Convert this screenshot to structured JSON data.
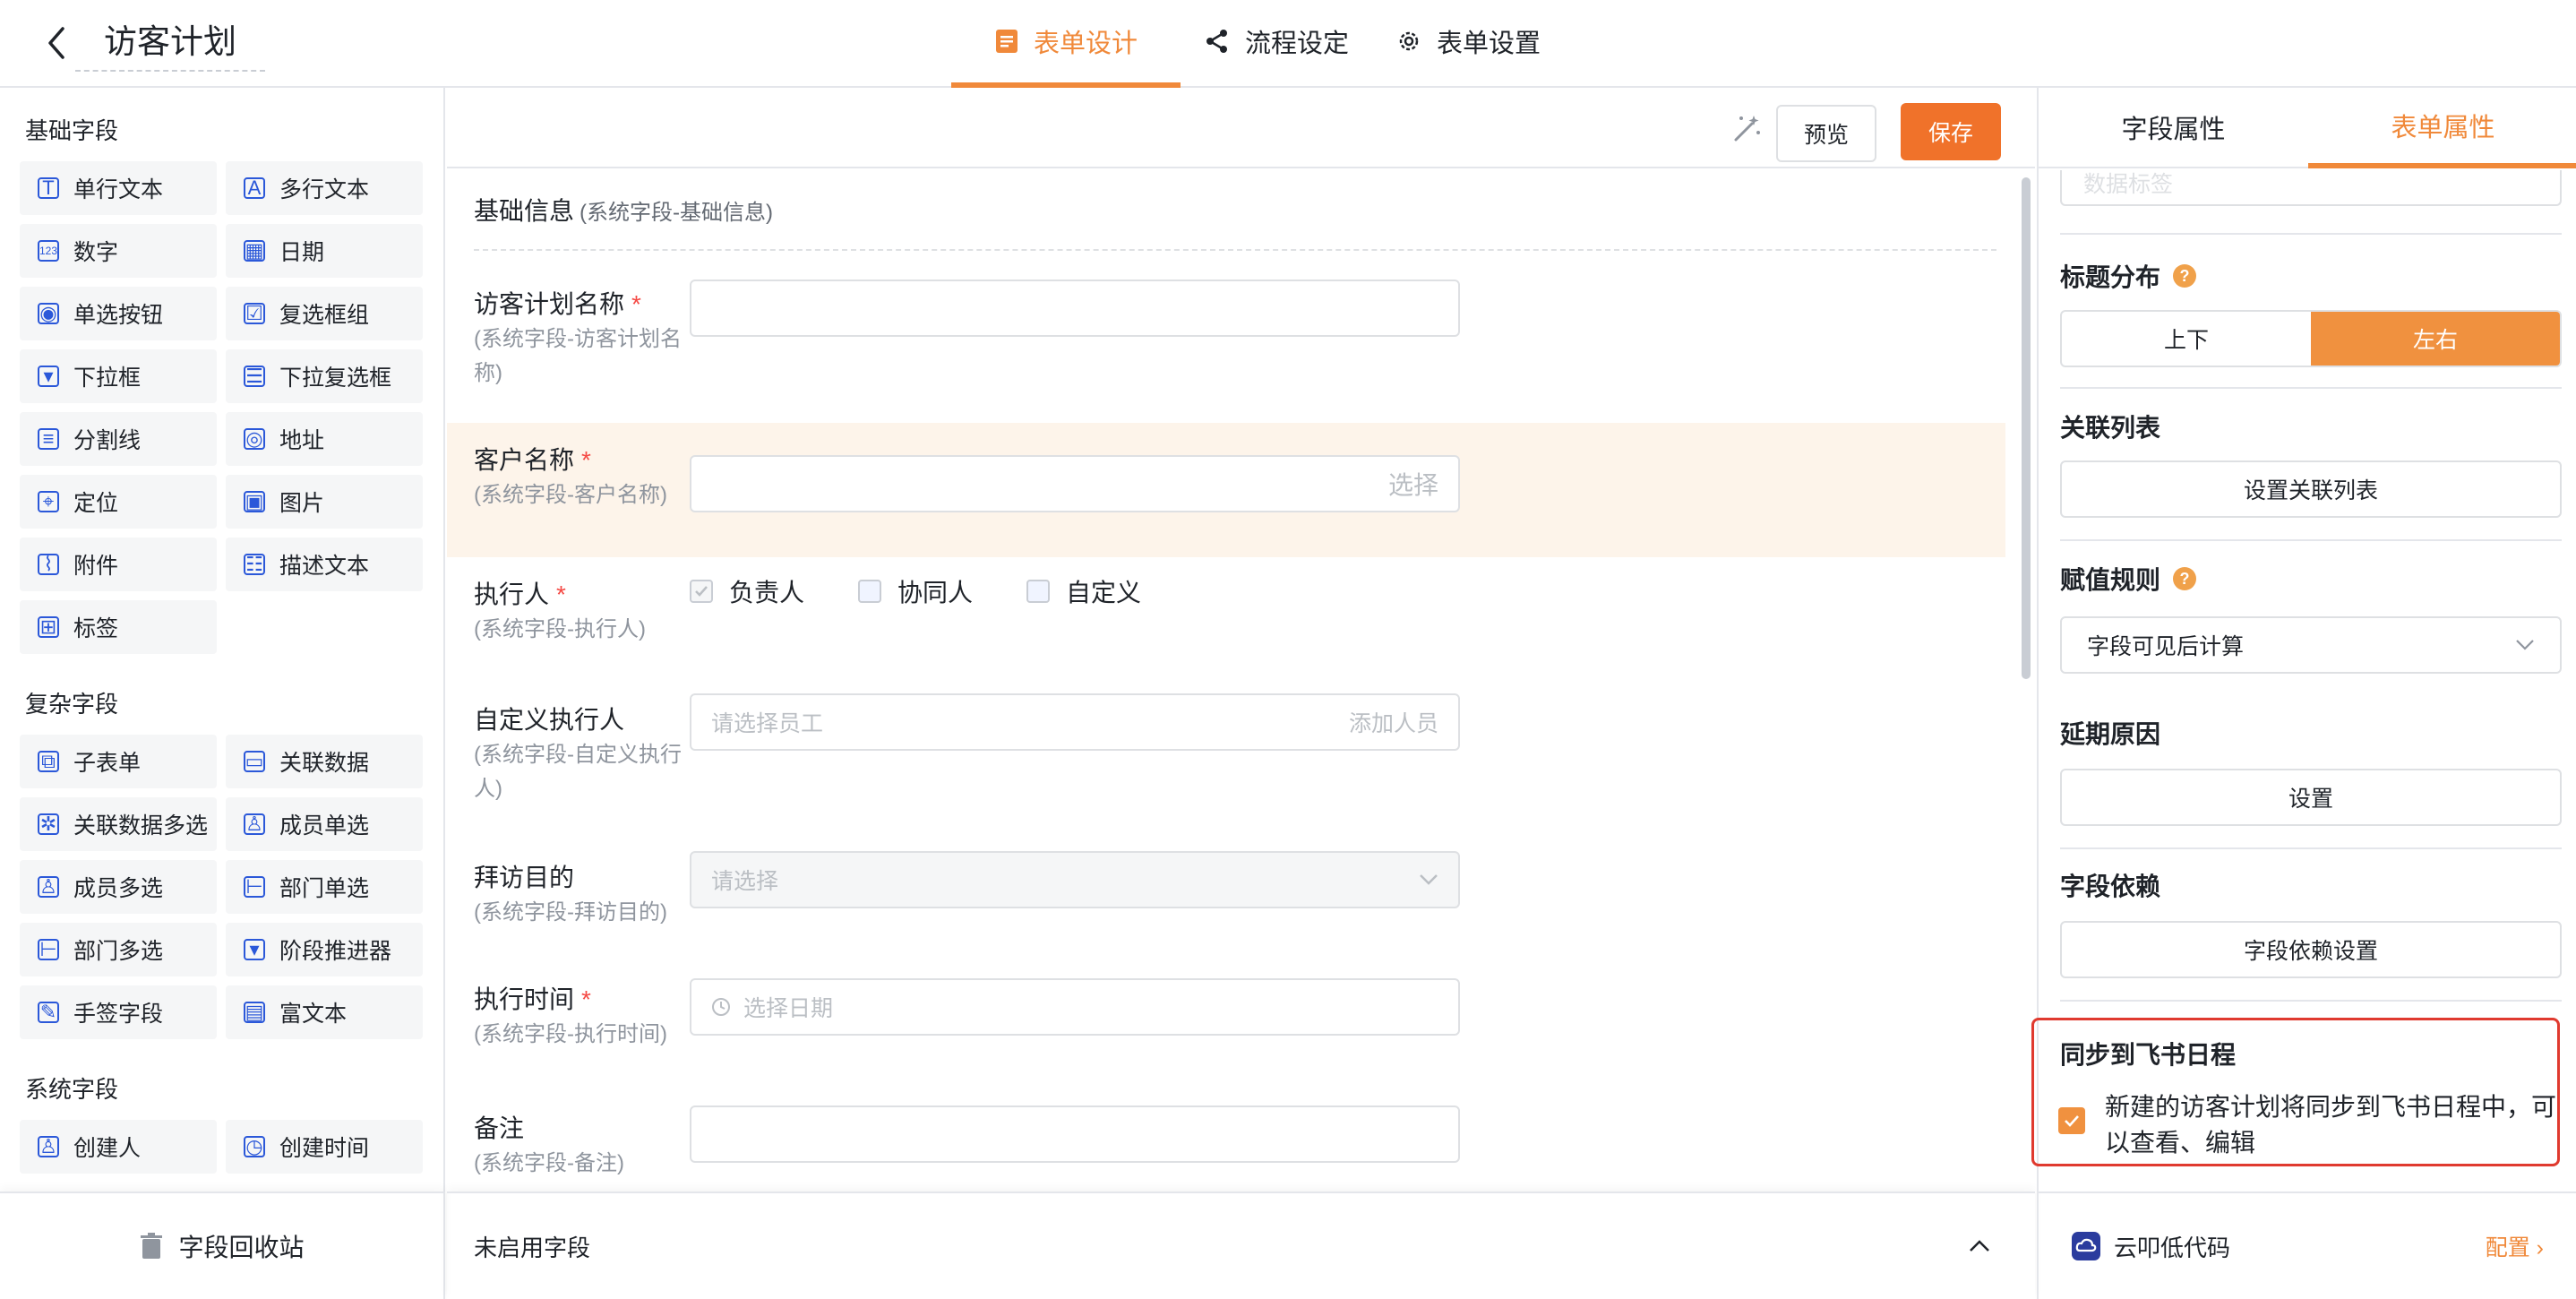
{
  "header": {
    "title": "访客计划",
    "tabs": [
      {
        "label": "表单设计",
        "active": true
      },
      {
        "label": "流程设定",
        "active": false
      },
      {
        "label": "表单设置",
        "active": false
      }
    ]
  },
  "left_panel": {
    "basic_title": "基础字段",
    "basic_fields": [
      "单行文本",
      "多行文本",
      "数字",
      "日期",
      "单选按钮",
      "复选框组",
      "下拉框",
      "下拉复选框",
      "分割线",
      "地址",
      "定位",
      "图片",
      "附件",
      "描述文本",
      "标签"
    ],
    "complex_title": "复杂字段",
    "complex_fields": [
      "子表单",
      "关联数据",
      "关联数据多选",
      "成员单选",
      "成员多选",
      "部门单选",
      "部门多选",
      "阶段推进器",
      "手签字段",
      "富文本"
    ],
    "system_title": "系统字段",
    "system_fields": [
      "创建人",
      "创建时间"
    ],
    "recycle_label": "字段回收站"
  },
  "toolbar": {
    "preview_label": "预览",
    "save_label": "保存"
  },
  "form": {
    "section_title": "基础信息",
    "section_sub": "(系统字段-基础信息)",
    "fields": [
      {
        "label": "访客计划名称",
        "required": "*",
        "sub": "(系统字段-访客计划名称)",
        "placeholder": "",
        "right": ""
      },
      {
        "label": "客户名称",
        "required": "*",
        "sub": "(系统字段-客户名称)",
        "placeholder": "",
        "right": "选择"
      },
      {
        "label": "执行人",
        "required": "*",
        "sub": "(系统字段-执行人)",
        "options": [
          "负责人",
          "协同人",
          "自定义"
        ]
      },
      {
        "label": "自定义执行人",
        "required": "",
        "sub": "(系统字段-自定义执行人)",
        "placeholder": "请选择员工",
        "right": "添加人员"
      },
      {
        "label": "拜访目的",
        "required": "",
        "sub": "(系统字段-拜访目的)",
        "placeholder": "请选择",
        "right": ""
      },
      {
        "label": "执行时间",
        "required": "*",
        "sub": "(系统字段-执行时间)",
        "placeholder": "选择日期",
        "right": ""
      },
      {
        "label": "备注",
        "required": "",
        "sub": "(系统字段-备注)",
        "placeholder": "",
        "right": ""
      }
    ],
    "unused_label": "未启用字段"
  },
  "right_panel": {
    "tabs": [
      {
        "label": "字段属性",
        "active": false
      },
      {
        "label": "表单属性",
        "active": true
      }
    ],
    "cut_placeholder": "数据标签",
    "title_layout_label": "标题分布",
    "title_layout_options": [
      "上下",
      "左右"
    ],
    "title_layout_selected": "左右",
    "related_list_label": "关联列表",
    "related_list_button": "设置关联列表",
    "assign_rule_label": "赋值规则",
    "assign_rule_value": "字段可见后计算",
    "delay_reason_label": "延期原因",
    "delay_reason_button": "设置",
    "field_dep_label": "字段依赖",
    "field_dep_button": "字段依赖设置",
    "sync_label": "同步到飞书日程",
    "sync_text": "新建的访客计划将同步到飞书日程中，可以查看、编辑",
    "sync_checked": true,
    "brand_label": "云叩低代码",
    "config_label": "配置"
  },
  "colors": {
    "accent": "#f0893a",
    "save": "#f0722a",
    "highlight": "#e03a2f",
    "icon": "#2b58d9"
  }
}
